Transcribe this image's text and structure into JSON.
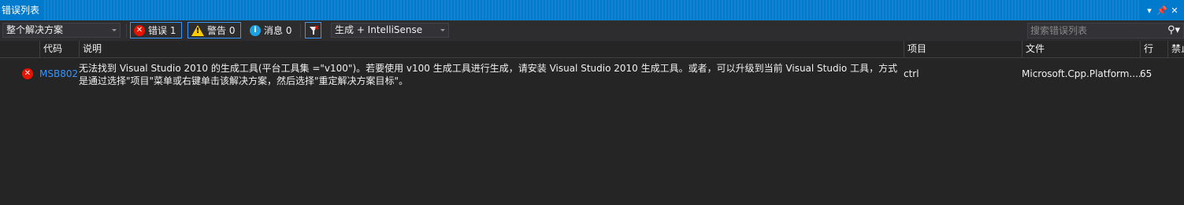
{
  "window": {
    "title": "错误列表"
  },
  "toolbar": {
    "scope_value": "整个解决方案",
    "errors_label": "错误 1",
    "warnings_label": "警告 0",
    "messages_label": "消息 0",
    "build_filter_value": "生成 + IntelliSense",
    "search_placeholder": "搜索错误列表"
  },
  "columns": [
    "代码",
    "说明",
    "项目",
    "文件",
    "行",
    "禁止"
  ],
  "rows": [
    {
      "code": "MSB802",
      "description": "无法找到 Visual Studio 2010 的生成工具(平台工具集 =\"v100\")。若要使用 v100 生成工具进行生成，请安装 Visual Studio 2010 生成工具。或者，可以升级到当前 Visual Studio 工具，方式是通过选择\"项目\"菜单或右键单击该解决方案，然后选择\"重定解决方案目标\"。",
      "project": "ctrl",
      "file": "Microsoft.Cpp.Platform....",
      "line": "65"
    }
  ],
  "colors": {
    "accent": "#007acc",
    "error": "#e51400",
    "warning": "#ffcc00",
    "info": "#1ba1e2",
    "link": "#3794ff",
    "background": "#252526"
  }
}
